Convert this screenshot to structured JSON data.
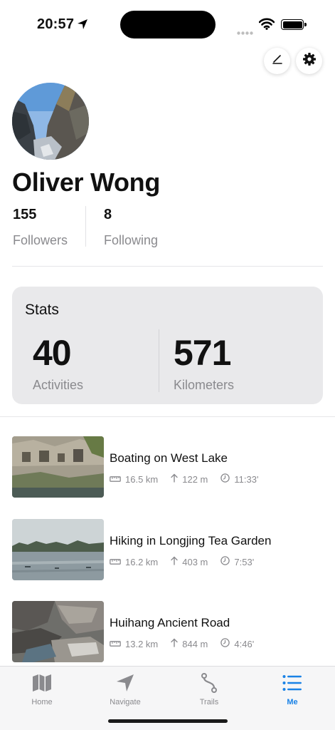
{
  "status": {
    "time": "20:57"
  },
  "profile": {
    "name": "Oliver Wong",
    "followers_count": "155",
    "followers_label": "Followers",
    "following_count": "8",
    "following_label": "Following"
  },
  "stats": {
    "title": "Stats",
    "activities_value": "40",
    "activities_label": "Activities",
    "km_value": "571",
    "km_label": "Kilometers"
  },
  "activities": [
    {
      "title": "Boating on West Lake",
      "distance": "16.5 km",
      "elevation": "122 m",
      "duration": "11:33'"
    },
    {
      "title": "Hiking in Longjing Tea Garden",
      "distance": "16.2 km",
      "elevation": "403 m",
      "duration": "7:53'"
    },
    {
      "title": "Huihang Ancient Road",
      "distance": "13.2 km",
      "elevation": "844 m",
      "duration": "4:46'"
    }
  ],
  "tabs": [
    {
      "label": "Home",
      "icon": "map-icon"
    },
    {
      "label": "Navigate",
      "icon": "navigate-arrow-icon"
    },
    {
      "label": "Trails",
      "icon": "route-icon"
    },
    {
      "label": "Me",
      "icon": "list-icon",
      "active": true
    }
  ],
  "colors": {
    "accent": "#1a82e6",
    "secondary_text": "#8a8a8e",
    "card_bg": "#e9e9eb"
  }
}
